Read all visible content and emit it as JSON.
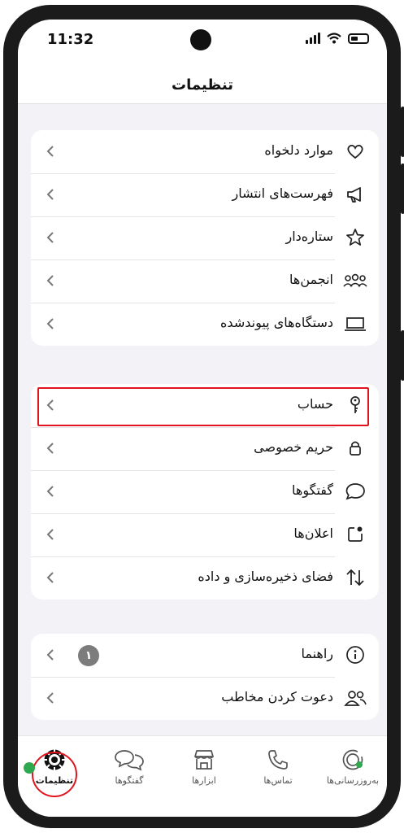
{
  "status_bar": {
    "time": "11:32"
  },
  "header": {
    "title": "تنظیمات"
  },
  "groups": [
    {
      "items": [
        {
          "label": "موارد دلخواه",
          "icon": "heart-icon"
        },
        {
          "label": "فهرست‌های انتشار",
          "icon": "megaphone-icon"
        },
        {
          "label": "ستاره‌دار",
          "icon": "star-icon"
        },
        {
          "label": "انجمن‌ها",
          "icon": "community-icon"
        },
        {
          "label": "دستگاه‌های پیوندشده",
          "icon": "laptop-icon"
        }
      ]
    },
    {
      "items": [
        {
          "label": "حساب",
          "icon": "key-icon"
        },
        {
          "label": "حریم خصوصی",
          "icon": "lock-icon"
        },
        {
          "label": "گفتگوها",
          "icon": "chat-bubble-icon"
        },
        {
          "label": "اعلان‌ها",
          "icon": "notification-icon"
        },
        {
          "label": "فضای ذخیره‌سازی و داده",
          "icon": "data-arrows-icon"
        }
      ]
    },
    {
      "items": [
        {
          "label": "راهنما",
          "icon": "info-icon",
          "badge": "۱"
        },
        {
          "label": "دعوت کردن مخاطب",
          "icon": "invite-contacts-icon"
        }
      ]
    }
  ],
  "tabbar": {
    "tabs": [
      {
        "label": "تنظیمات",
        "icon": "settings-gear-icon",
        "active": true
      },
      {
        "label": "گفتگوها",
        "icon": "chats-icon"
      },
      {
        "label": "ابزارها",
        "icon": "store-icon"
      },
      {
        "label": "تماس‌ها",
        "icon": "phone-icon"
      },
      {
        "label": "به‌روزرسانی‌ها",
        "icon": "updates-icon"
      }
    ]
  },
  "colors": {
    "accent_green": "#2fa84f",
    "highlight_red": "#e0141e",
    "background": "#f2f2f7"
  }
}
